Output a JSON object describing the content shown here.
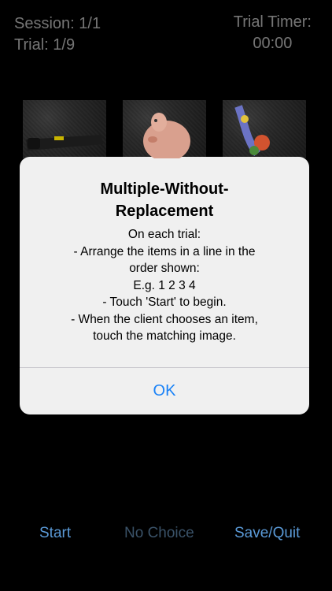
{
  "header": {
    "session": "Session: 1/1",
    "trial": "Trial: 1/9",
    "timer_label": "Trial Timer:",
    "timer_value": "00:00"
  },
  "thumbnails": [
    {
      "icon": "flashlight-image"
    },
    {
      "icon": "pig-toy-image"
    },
    {
      "icon": "toy-ring-image"
    }
  ],
  "alert": {
    "title_lines": [
      "Multiple-Without-",
      "Replacement"
    ],
    "message_lines": [
      "On each trial:",
      "- Arrange the items in a line in the",
      "order shown:",
      "E.g. 1 2 3 4",
      "- Touch 'Start' to begin.",
      "- When the client chooses an item,",
      "touch the matching image."
    ],
    "ok_label": "OK"
  },
  "toolbar": {
    "start": "Start",
    "no_choice": "No Choice",
    "save_quit": "Save/Quit"
  },
  "colors": {
    "background": "#000000",
    "accent_link": "#5a99d6",
    "disabled": "#3a5268",
    "alert_button": "#1a82f7"
  }
}
